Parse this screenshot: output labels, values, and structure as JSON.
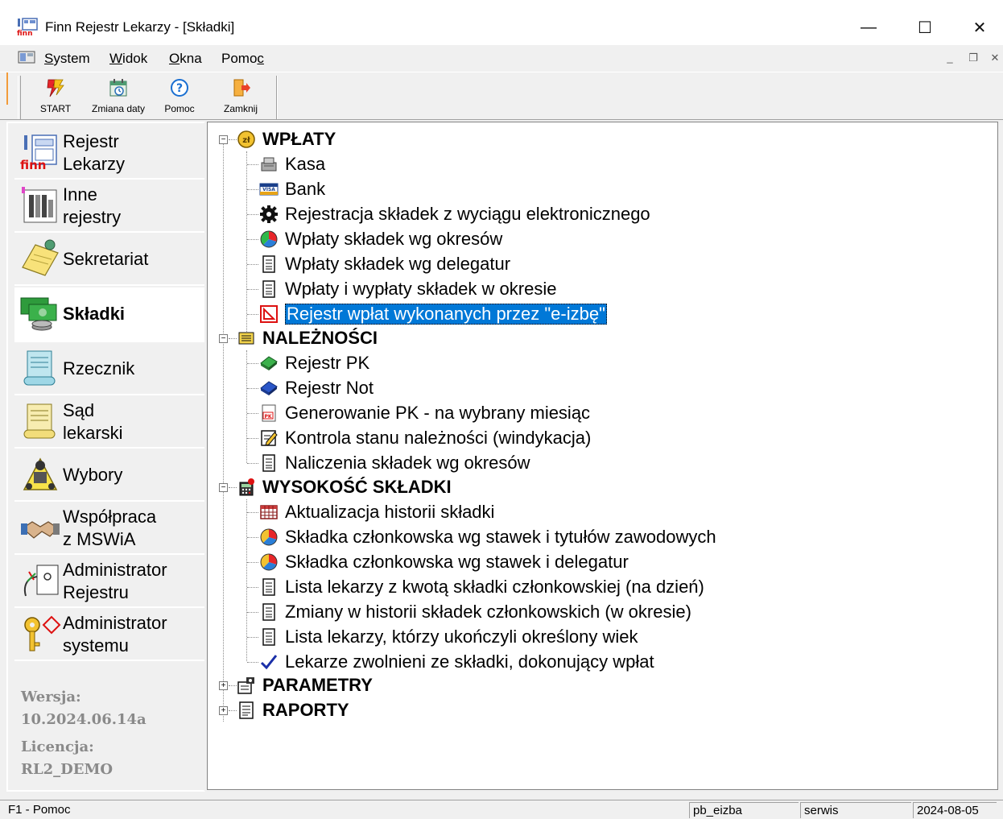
{
  "window": {
    "title": "Finn Rejestr Lekarzy - [Składki]",
    "controls": {
      "minimize": "—",
      "maximize": "☐",
      "close": "✕"
    }
  },
  "menu": {
    "items": [
      {
        "label": "System",
        "underline": "S",
        "rest": "ystem"
      },
      {
        "label": "Widok",
        "underline": "W",
        "rest": "idok"
      },
      {
        "label": "Okna",
        "underline": "O",
        "rest": "kna"
      },
      {
        "label": "Pomoc",
        "prefix": "Pomo",
        "underline": "c"
      }
    ],
    "mdi_controls": {
      "minimize": "_",
      "restore": "❐",
      "close": "✕"
    }
  },
  "toolbar": {
    "buttons": [
      {
        "label": "START",
        "icon": "start-icon"
      },
      {
        "label": "Zmiana daty",
        "icon": "calendar-icon"
      },
      {
        "label": "Pomoc",
        "icon": "help-icon"
      },
      {
        "label": "Zamknij",
        "icon": "exit-icon"
      }
    ]
  },
  "leftnav": {
    "items": [
      {
        "label_line1": "Rejestr",
        "label_line2": "Lekarzy",
        "icon": "finn-registry-icon"
      },
      {
        "label_line1": "Inne",
        "label_line2": "rejestry",
        "icon": "other-registries-icon"
      },
      {
        "label_line1": "Sekretariat",
        "label_line2": "",
        "icon": "secretariat-icon"
      },
      {
        "label_line1": "Składki",
        "label_line2": "",
        "icon": "fees-icon",
        "active": true
      },
      {
        "label_line1": "Rzecznik",
        "label_line2": "",
        "icon": "ombudsman-icon"
      },
      {
        "label_line1": "Sąd",
        "label_line2": "lekarski",
        "icon": "court-icon"
      },
      {
        "label_line1": "Wybory",
        "label_line2": "",
        "icon": "elections-icon"
      },
      {
        "label_line1": "Współpraca",
        "label_line2": "z MSWiA",
        "icon": "handshake-icon"
      },
      {
        "label_line1": "Administrator",
        "label_line2": "Rejestru",
        "icon": "registry-admin-icon"
      },
      {
        "label_line1": "Administrator",
        "label_line2": "systemu",
        "icon": "keys-icon"
      }
    ],
    "version_label": "Wersja:",
    "version_value": "10.2024.06.14a",
    "license_label": "Licencja:",
    "license_value": "RL2_DEMO"
  },
  "tree": {
    "sections": [
      {
        "label": "WPŁATY",
        "icon": "coin-icon",
        "expanded": true,
        "children": [
          {
            "label": "Kasa",
            "icon": "cash-register-icon"
          },
          {
            "label": "Bank",
            "icon": "visa-card-icon"
          },
          {
            "label": "Rejestracja składek z wyciągu elektronicznego",
            "icon": "gear-icon"
          },
          {
            "label": "Wpłaty składek wg okresów",
            "icon": "pie-chart-icon"
          },
          {
            "label": "Wpłaty składek wg delegatur",
            "icon": "document-icon"
          },
          {
            "label": "Wpłaty i wypłaty składek w okresie",
            "icon": "document-icon"
          },
          {
            "label": "Rejestr wpłat wykonanych przez \"e-izbę\"",
            "icon": "e-chamber-icon",
            "selected": true
          }
        ]
      },
      {
        "label": "NALEŻNOŚCI",
        "icon": "ledger-icon",
        "expanded": true,
        "children": [
          {
            "label": "Rejestr PK",
            "icon": "green-book-icon"
          },
          {
            "label": "Rejestr Not",
            "icon": "blue-book-icon"
          },
          {
            "label": "Generowanie PK - na wybrany miesiąc",
            "icon": "pk-doc-icon"
          },
          {
            "label": "Kontrola stanu należności (windykacja)",
            "icon": "edit-doc-icon"
          },
          {
            "label": "Naliczenia składek wg okresów",
            "icon": "document-icon"
          }
        ]
      },
      {
        "label": "WYSOKOŚĆ SKŁADKI",
        "icon": "calculator-icon",
        "expanded": true,
        "children": [
          {
            "label": "Aktualizacja historii składki",
            "icon": "table-grid-icon"
          },
          {
            "label": "Składka członkowska wg stawek i tytułów zawodowych",
            "icon": "pie-chart-icon"
          },
          {
            "label": "Składka członkowska wg stawek i delegatur",
            "icon": "pie-chart-icon"
          },
          {
            "label": "Lista lekarzy z kwotą składki członkowskiej (na dzień)",
            "icon": "document-icon"
          },
          {
            "label": "Zmiany w historii składek członkowskich (w okresie)",
            "icon": "document-icon"
          },
          {
            "label": "Lista lekarzy, którzy ukończyli określony wiek",
            "icon": "document-icon"
          },
          {
            "label": "Lekarze zwolnieni ze składki, dokonujący wpłat",
            "icon": "checkmark-icon"
          }
        ]
      },
      {
        "label": "PARAMETRY",
        "icon": "parameters-icon",
        "expanded": false,
        "children": []
      },
      {
        "label": "RAPORTY",
        "icon": "reports-icon",
        "expanded": false,
        "children": []
      }
    ],
    "expander_open": "−",
    "expander_closed": "+"
  },
  "statusbar": {
    "help": "F1 - Pomoc",
    "db": "pb_eizba",
    "user": "serwis",
    "date": "2024-08-05"
  }
}
